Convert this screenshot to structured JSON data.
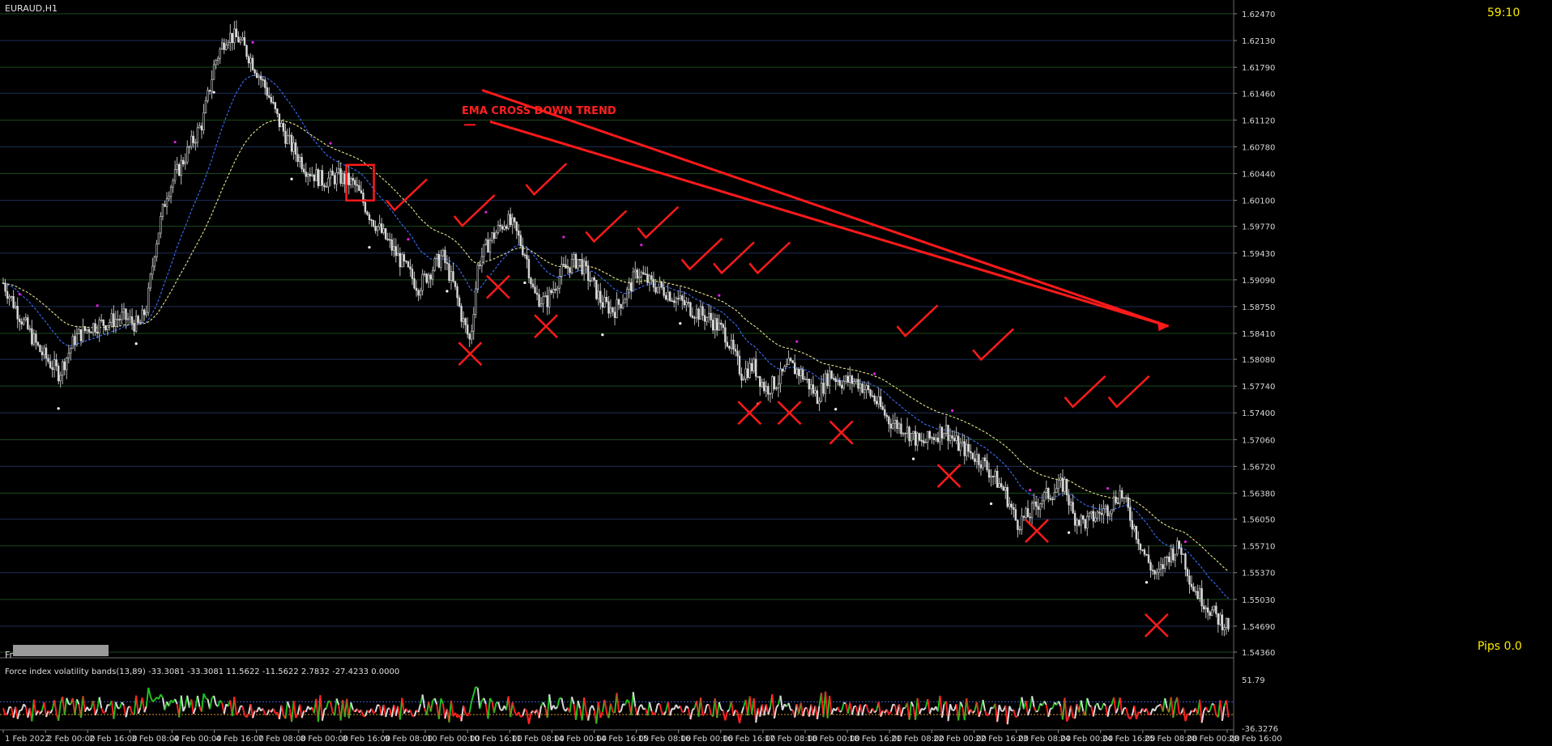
{
  "chart_data": {
    "type": "candlestick",
    "symbol_label": "EURAUD,H1",
    "timer": "59:10",
    "pips_label": "Pips 0.0",
    "bottom_left_label": "Fr",
    "annotation": "EMA CROSS DOWN TREND",
    "ylim": [
      1.5436,
      1.6247
    ],
    "y_ticks": [
      "1.62470",
      "1.62130",
      "1.61790",
      "1.61460",
      "1.61120",
      "1.60780",
      "1.60440",
      "1.60100",
      "1.59770",
      "1.59430",
      "1.59090",
      "1.58750",
      "1.58410",
      "1.58080",
      "1.57740",
      "1.57400",
      "1.57060",
      "1.56720",
      "1.56380",
      "1.56050",
      "1.55710",
      "1.55370",
      "1.55030",
      "1.54690",
      "1.54360"
    ],
    "x_ticks": [
      "1 Feb 2022",
      "2 Feb 00:00",
      "2 Feb 16:00",
      "3 Feb 08:00",
      "4 Feb 00:00",
      "4 Feb 16:00",
      "7 Feb 08:00",
      "8 Feb 00:00",
      "8 Feb 16:00",
      "9 Feb 08:00",
      "10 Feb 00:00",
      "10 Feb 16:00",
      "11 Feb 08:00",
      "14 Feb 00:00",
      "14 Feb 16:00",
      "15 Feb 08:00",
      "16 Feb 00:00",
      "16 Feb 16:00",
      "17 Feb 08:00",
      "18 Feb 00:00",
      "18 Feb 16:00",
      "21 Feb 08:00",
      "22 Feb 00:00",
      "22 Feb 16:00",
      "23 Feb 08:00",
      "24 Feb 00:00",
      "24 Feb 16:00",
      "25 Feb 08:00",
      "28 Feb 00:00",
      "28 Feb 16:00"
    ],
    "price_keypoints": [
      [
        0,
        1.5905
      ],
      [
        4,
        1.5865
      ],
      [
        9,
        1.582
      ],
      [
        14,
        1.579
      ],
      [
        18,
        1.5835
      ],
      [
        22,
        1.585
      ],
      [
        26,
        1.5855
      ],
      [
        30,
        1.5862
      ],
      [
        34,
        1.585
      ],
      [
        36,
        1.5875
      ],
      [
        38,
        1.595
      ],
      [
        41,
        1.602
      ],
      [
        45,
        1.606
      ],
      [
        50,
        1.611
      ],
      [
        53,
        1.6185
      ],
      [
        56,
        1.622
      ],
      [
        59,
        1.6215
      ],
      [
        62,
        1.619
      ],
      [
        66,
        1.615
      ],
      [
        69,
        1.611
      ],
      [
        72,
        1.608
      ],
      [
        76,
        1.605
      ],
      [
        80,
        1.6035
      ],
      [
        84,
        1.604
      ],
      [
        88,
        1.603
      ],
      [
        92,
        1.599
      ],
      [
        96,
        1.596
      ],
      [
        100,
        1.593
      ],
      [
        104,
        1.59
      ],
      [
        107,
        1.592
      ],
      [
        110,
        1.594
      ],
      [
        113,
        1.59
      ],
      [
        115,
        1.586
      ],
      [
        117,
        1.583
      ],
      [
        119,
        1.593
      ],
      [
        122,
        1.596
      ],
      [
        126,
        1.5985
      ],
      [
        128,
        1.5975
      ],
      [
        131,
        1.594
      ],
      [
        133,
        1.589
      ],
      [
        136,
        1.588
      ],
      [
        140,
        1.592
      ],
      [
        144,
        1.5935
      ],
      [
        147,
        1.591
      ],
      [
        150,
        1.588
      ],
      [
        153,
        1.587
      ],
      [
        156,
        1.589
      ],
      [
        159,
        1.592
      ],
      [
        162,
        1.5905
      ],
      [
        166,
        1.5895
      ],
      [
        170,
        1.588
      ],
      [
        173,
        1.587
      ],
      [
        177,
        1.586
      ],
      [
        181,
        1.584
      ],
      [
        185,
        1.579
      ],
      [
        188,
        1.58
      ],
      [
        191,
        1.577
      ],
      [
        194,
        1.578
      ],
      [
        197,
        1.58
      ],
      [
        200,
        1.579
      ],
      [
        204,
        1.576
      ],
      [
        207,
        1.579
      ],
      [
        210,
        1.578
      ],
      [
        214,
        1.578
      ],
      [
        218,
        1.576
      ],
      [
        222,
        1.573
      ],
      [
        226,
        1.572
      ],
      [
        230,
        1.57
      ],
      [
        233,
        1.571
      ],
      [
        236,
        1.572
      ],
      [
        239,
        1.57
      ],
      [
        242,
        1.569
      ],
      [
        245,
        1.568
      ],
      [
        248,
        1.566
      ],
      [
        251,
        1.564
      ],
      [
        254,
        1.56
      ],
      [
        257,
        1.561
      ],
      [
        260,
        1.563
      ],
      [
        263,
        1.564
      ],
      [
        266,
        1.565
      ],
      [
        268,
        1.561
      ],
      [
        271,
        1.56
      ],
      [
        274,
        1.561
      ],
      [
        277,
        1.562
      ],
      [
        280,
        1.564
      ],
      [
        283,
        1.56
      ],
      [
        286,
        1.556
      ],
      [
        289,
        1.553
      ],
      [
        292,
        1.556
      ],
      [
        295,
        1.557
      ],
      [
        298,
        1.552
      ],
      [
        301,
        1.55
      ],
      [
        304,
        1.548
      ],
      [
        307,
        1.547
      ]
    ],
    "trend_lines": [
      {
        "p1": [
          120,
          1.615
        ],
        "p2": [
          292,
          1.585
        ]
      },
      {
        "p1": [
          122,
          1.611
        ],
        "p2": [
          292,
          1.585
        ]
      }
    ],
    "indicator": {
      "label": "Force index volatility bands(13,89) -33.3081 -33.3081 11.5622 -11.5622 2.7832 -27.4233 0.0000",
      "ylim": [
        -36.3276,
        51.79
      ],
      "y_ticks": [
        "51.79",
        "-36.3276"
      ],
      "upper_band": 11.5622,
      "lower_band": -11.5622
    },
    "grid": true
  }
}
